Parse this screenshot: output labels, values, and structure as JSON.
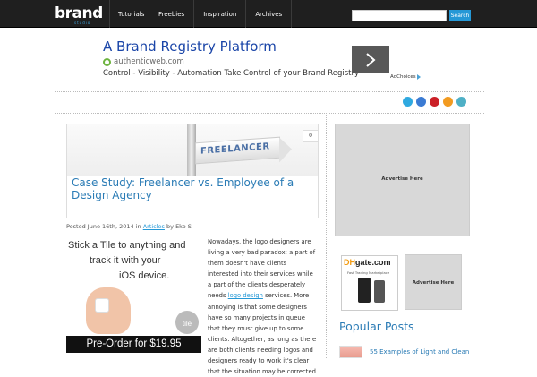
{
  "header": {
    "logo_text": "brand",
    "logo_sub": "studio",
    "nav": [
      "Tutorials",
      "Freebies",
      "Inspiration",
      "Archives"
    ],
    "search_placeholder": "",
    "search_button": "Search"
  },
  "ad": {
    "title": "A Brand Registry Platform",
    "domain": "authenticweb.com",
    "description": "Control - Visibility - Automation Take Control of your Brand Registry",
    "adchoices": "AdChoices"
  },
  "social_icons": [
    {
      "name": "twitter-icon",
      "color": "#2fa9e0"
    },
    {
      "name": "facebook-icon",
      "color": "#3b7bd3"
    },
    {
      "name": "pinterest-icon",
      "color": "#cb2027"
    },
    {
      "name": "rss-icon",
      "color": "#f29b21"
    },
    {
      "name": "email-icon",
      "color": "#4fb0c6"
    }
  ],
  "featured": {
    "sign_text": "FREELANCER",
    "comment_count": "0",
    "title": "Case Study: Freelancer vs. Employee of a Design Agency"
  },
  "meta": {
    "posted": "Posted June 16th, 2014 in",
    "category": "Articles",
    "by": "by Eko S"
  },
  "tile_ad": {
    "line1": "Stick a Tile to anything and",
    "line2": "track it with your",
    "line3": "iOS device.",
    "logo": "tile",
    "order": "Pre-Order for $19.95"
  },
  "article": {
    "text_before_link": "Nowadays, the logo designers are living a very bad paradox: a part of them doesn't have clients interested into their services while a part of the clients desperately needs ",
    "link": "logo design",
    "text_after_link": " services. More annoying is that some designers have so many projects in queue that they must give up to some clients. Altogether, as long as there are both clients needing logos and designers ready to work it's clear that the situation may be corrected."
  },
  "sidebar": {
    "advertise_big": "Advertise Here",
    "dhgate_logo_a": "DH",
    "dhgate_logo_b": "gate",
    "dhgate_logo_c": ".com",
    "dhgate_sub": "Fast Trading Marketplace",
    "advertise_small": "Advertise Here",
    "popular_title": "Popular Posts",
    "popular_items": [
      "55 Examples of Light and Clean"
    ]
  }
}
